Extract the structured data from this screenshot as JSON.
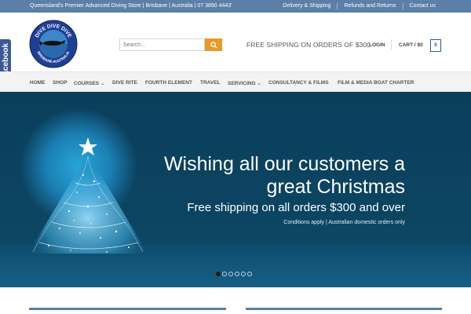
{
  "topbar": {
    "tagline": "Queensland's Premier Advanced Diving Store | Brisbane | Australia | 07 3890 4443'",
    "links": [
      "Delivery & Shipping",
      "Refunds and Returns",
      "Contact us"
    ]
  },
  "logo": {
    "top_text": "DIVE DIVE DIVE",
    "bottom_text": "BRISBANE AUSTRALIA"
  },
  "search": {
    "placeholder": "Search..."
  },
  "header": {
    "shipping_message": "FREE SHIPPING ON ORDERS OF $300",
    "login": "LOGIN",
    "cart": "CART / $0",
    "cart_count": "0"
  },
  "facebook": {
    "label": "facebook"
  },
  "nav": {
    "items": [
      {
        "label": "HOME"
      },
      {
        "label": "SHOP"
      },
      {
        "label": "COURSES"
      },
      {
        "label": "DIVE RITE"
      },
      {
        "label": "FOURTH ELEMENT"
      },
      {
        "label": "TRAVEL"
      },
      {
        "label": "SERVICING"
      },
      {
        "label": "CONSULTANCY & FILMS"
      },
      {
        "label": "FILM & MEDIA BOAT CHARTER"
      }
    ]
  },
  "hero": {
    "line1": "Wishing all our customers a",
    "line2": "great Christmas",
    "subheading": "Free shipping on all orders $300 and over",
    "note": "Conditions apply | Australian domestic orders only",
    "slide_count": 6,
    "active_slide": 1
  },
  "colors": {
    "topbar": "#5b7fa6",
    "accent_orange": "#e69a2a",
    "brand_blue": "#2b5c8a",
    "facebook_blue": "#3b5998",
    "hero_dark": "#0a3f5c"
  }
}
